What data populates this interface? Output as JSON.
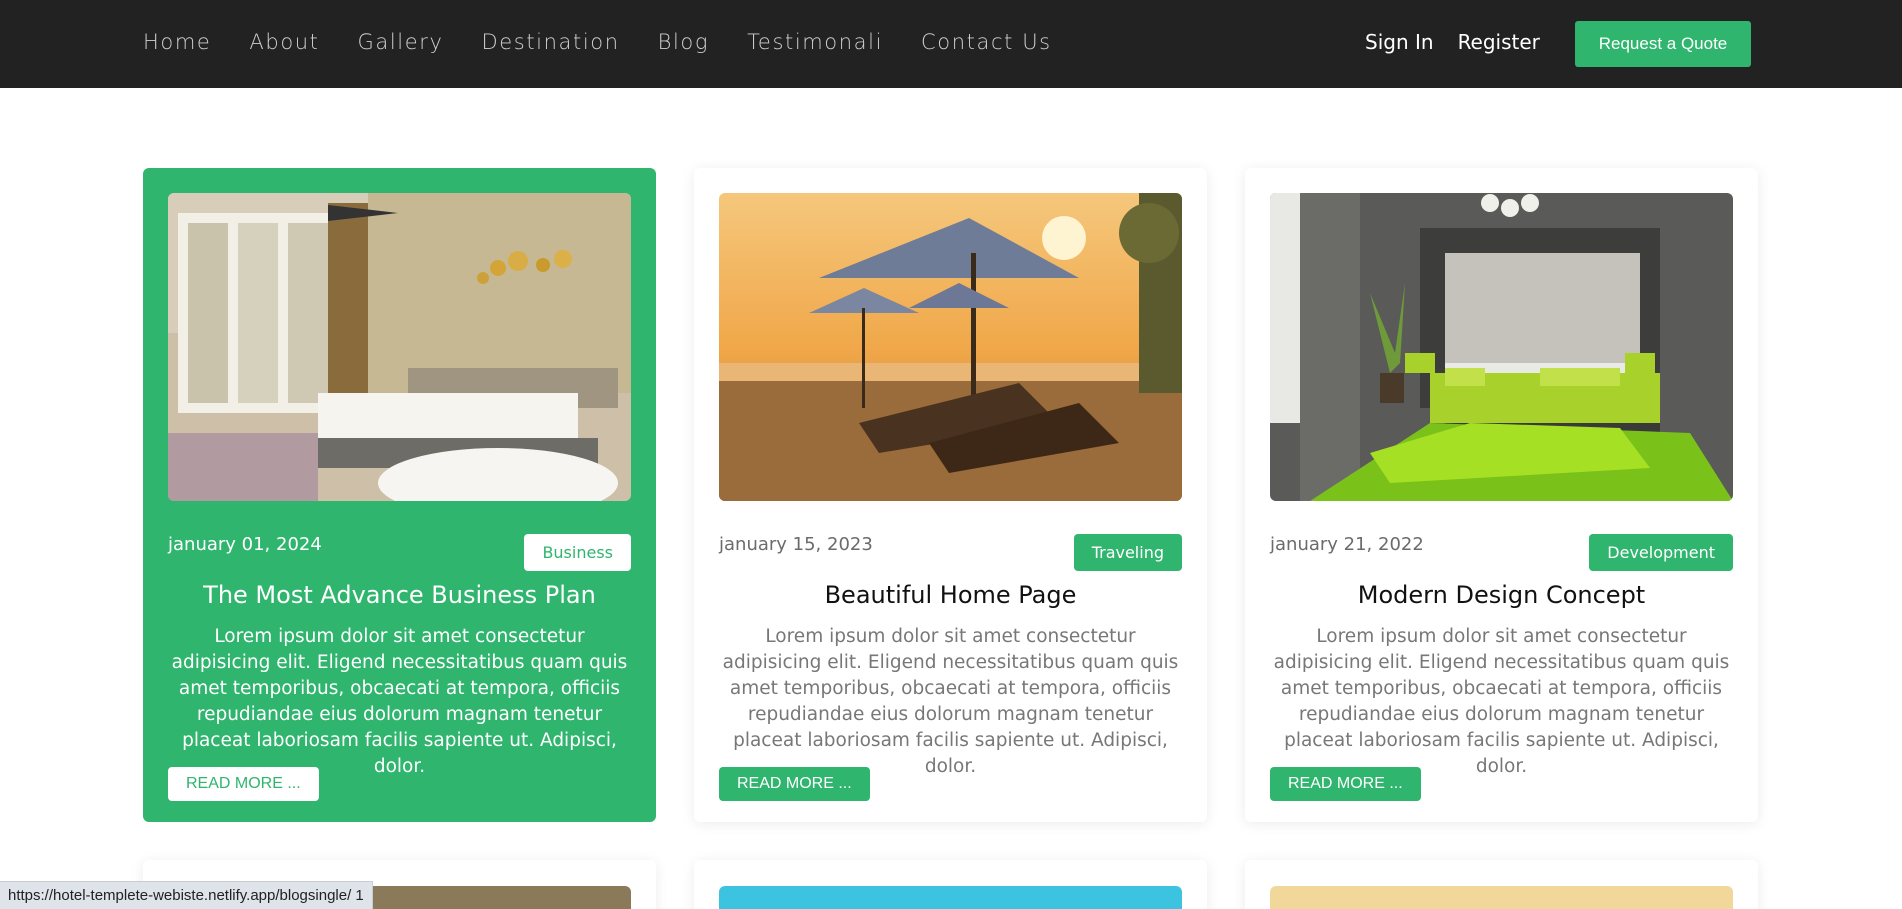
{
  "nav": {
    "links": [
      "Home",
      "About",
      "Gallery",
      "Destination",
      "Blog",
      "Testimonali",
      "Contact Us"
    ],
    "sign_in": "Sign In",
    "register": "Register",
    "quote_button": "Request a Quote"
  },
  "cards": [
    {
      "date": "january 01, 2024",
      "tag": "Business",
      "title": "The Most Advance Business Plan",
      "text": "Lorem ipsum dolor sit amet consectetur adipisicing elit. Eligend necessitatibus quam quis amet temporibus, obcaecati at tempora, officiis repudiandae eius dolorum magnam tenetur placeat laboriosam facilis sapiente ut. Adipisci, dolor.",
      "button": "READ MORE ..."
    },
    {
      "date": "january 15, 2023",
      "tag": "Traveling",
      "title": "Beautiful Home Page",
      "text": "Lorem ipsum dolor sit amet consectetur adipisicing elit. Eligend necessitatibus quam quis amet temporibus, obcaecati at tempora, officiis repudiandae eius dolorum magnam tenetur placeat laboriosam facilis sapiente ut. Adipisci, dolor.",
      "button": "READ MORE ..."
    },
    {
      "date": "january 21, 2022",
      "tag": "Development",
      "title": "Modern Design Concept",
      "text": "Lorem ipsum dolor sit amet consectetur adipisicing elit. Eligend necessitatibus quam quis amet temporibus, obcaecati at tempora, officiis repudiandae eius dolorum magnam tenetur placeat laboriosam facilis sapiente ut. Adipisci, dolor.",
      "button": "READ MORE ..."
    }
  ],
  "status_url": "https://hotel-templete-webiste.netlify.app/blogsingle/ 1",
  "colors": {
    "accent": "#2fb56e",
    "navbar": "#222222"
  }
}
